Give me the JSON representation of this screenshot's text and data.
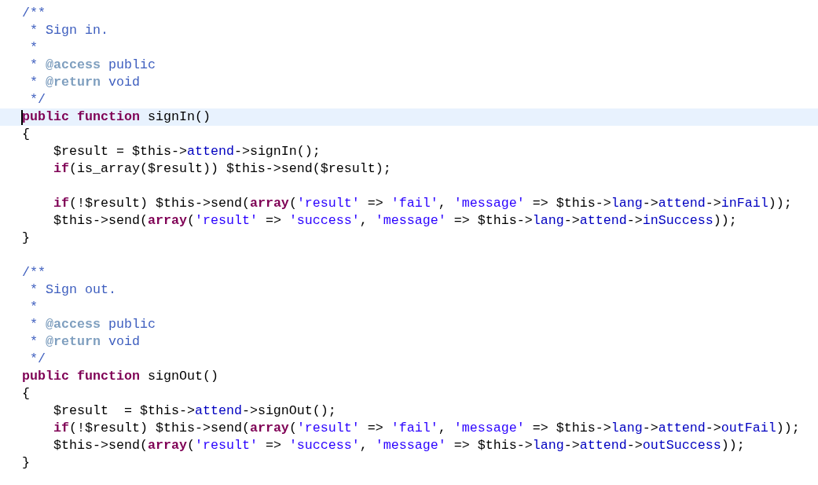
{
  "editor": {
    "lines": [
      {
        "kind": "code",
        "current": false,
        "tokens": [
          {
            "kind": "comment",
            "text": "/**"
          }
        ]
      },
      {
        "kind": "code",
        "current": false,
        "tokens": [
          {
            "kind": "comment",
            "text": " * Sign in."
          }
        ]
      },
      {
        "kind": "code",
        "current": false,
        "tokens": [
          {
            "kind": "comment",
            "text": " *"
          }
        ]
      },
      {
        "kind": "code",
        "current": false,
        "tokens": [
          {
            "kind": "comment",
            "text": " * "
          },
          {
            "kind": "doctag",
            "text": "@access"
          },
          {
            "kind": "comment",
            "text": " public"
          }
        ]
      },
      {
        "kind": "code",
        "current": false,
        "tokens": [
          {
            "kind": "comment",
            "text": " * "
          },
          {
            "kind": "doctag",
            "text": "@return"
          },
          {
            "kind": "comment",
            "text": " void"
          }
        ]
      },
      {
        "kind": "code",
        "current": false,
        "tokens": [
          {
            "kind": "comment",
            "text": " */"
          }
        ]
      },
      {
        "kind": "code",
        "current": true,
        "tokens": [
          {
            "kind": "keyword",
            "text": "public"
          },
          {
            "kind": "keyword",
            "text": " function"
          },
          {
            "kind": "plain",
            "text": " signIn()"
          }
        ]
      },
      {
        "kind": "code",
        "current": false,
        "tokens": [
          {
            "kind": "plain",
            "text": "{"
          }
        ]
      },
      {
        "kind": "code",
        "current": false,
        "tokens": [
          {
            "kind": "plain",
            "text": "    $result = $this->"
          },
          {
            "kind": "field",
            "text": "attend"
          },
          {
            "kind": "plain",
            "text": "->signIn();"
          }
        ]
      },
      {
        "kind": "code",
        "current": false,
        "tokens": [
          {
            "kind": "keyword",
            "text": "    if"
          },
          {
            "kind": "plain",
            "text": "(is_array($result)) $this->send($result);"
          }
        ]
      },
      {
        "kind": "blank",
        "current": false
      },
      {
        "kind": "code",
        "current": false,
        "tokens": [
          {
            "kind": "keyword",
            "text": "    if"
          },
          {
            "kind": "plain",
            "text": "(!$result) $this->send("
          },
          {
            "kind": "keyword",
            "text": "array"
          },
          {
            "kind": "plain",
            "text": "("
          },
          {
            "kind": "string",
            "text": "'result'"
          },
          {
            "kind": "plain",
            "text": " => "
          },
          {
            "kind": "string",
            "text": "'fail'"
          },
          {
            "kind": "plain",
            "text": ", "
          },
          {
            "kind": "string",
            "text": "'message'"
          },
          {
            "kind": "plain",
            "text": " => $this->"
          },
          {
            "kind": "field",
            "text": "lang"
          },
          {
            "kind": "plain",
            "text": "->"
          },
          {
            "kind": "field",
            "text": "attend"
          },
          {
            "kind": "plain",
            "text": "->"
          },
          {
            "kind": "field",
            "text": "inFail"
          },
          {
            "kind": "plain",
            "text": "));"
          }
        ]
      },
      {
        "kind": "code",
        "current": false,
        "tokens": [
          {
            "kind": "plain",
            "text": "    $this->send("
          },
          {
            "kind": "keyword",
            "text": "array"
          },
          {
            "kind": "plain",
            "text": "("
          },
          {
            "kind": "string",
            "text": "'result'"
          },
          {
            "kind": "plain",
            "text": " => "
          },
          {
            "kind": "string",
            "text": "'success'"
          },
          {
            "kind": "plain",
            "text": ", "
          },
          {
            "kind": "string",
            "text": "'message'"
          },
          {
            "kind": "plain",
            "text": " => $this->"
          },
          {
            "kind": "field",
            "text": "lang"
          },
          {
            "kind": "plain",
            "text": "->"
          },
          {
            "kind": "field",
            "text": "attend"
          },
          {
            "kind": "plain",
            "text": "->"
          },
          {
            "kind": "field",
            "text": "inSuccess"
          },
          {
            "kind": "plain",
            "text": "));"
          }
        ]
      },
      {
        "kind": "code",
        "current": false,
        "tokens": [
          {
            "kind": "plain",
            "text": "}"
          }
        ]
      },
      {
        "kind": "blank",
        "current": false
      },
      {
        "kind": "code",
        "current": false,
        "tokens": [
          {
            "kind": "comment",
            "text": "/**"
          }
        ]
      },
      {
        "kind": "code",
        "current": false,
        "tokens": [
          {
            "kind": "comment",
            "text": " * Sign out."
          }
        ]
      },
      {
        "kind": "code",
        "current": false,
        "tokens": [
          {
            "kind": "comment",
            "text": " *"
          }
        ]
      },
      {
        "kind": "code",
        "current": false,
        "tokens": [
          {
            "kind": "comment",
            "text": " * "
          },
          {
            "kind": "doctag",
            "text": "@access"
          },
          {
            "kind": "comment",
            "text": " public"
          }
        ]
      },
      {
        "kind": "code",
        "current": false,
        "tokens": [
          {
            "kind": "comment",
            "text": " * "
          },
          {
            "kind": "doctag",
            "text": "@return"
          },
          {
            "kind": "comment",
            "text": " void"
          }
        ]
      },
      {
        "kind": "code",
        "current": false,
        "tokens": [
          {
            "kind": "comment",
            "text": " */"
          }
        ]
      },
      {
        "kind": "code",
        "current": false,
        "tokens": [
          {
            "kind": "keyword",
            "text": "public"
          },
          {
            "kind": "keyword",
            "text": " function"
          },
          {
            "kind": "plain",
            "text": " signOut()"
          }
        ]
      },
      {
        "kind": "code",
        "current": false,
        "tokens": [
          {
            "kind": "plain",
            "text": "{"
          }
        ]
      },
      {
        "kind": "code",
        "current": false,
        "tokens": [
          {
            "kind": "plain",
            "text": "    $result  = $this->"
          },
          {
            "kind": "field",
            "text": "attend"
          },
          {
            "kind": "plain",
            "text": "->signOut();"
          }
        ]
      },
      {
        "kind": "code",
        "current": false,
        "tokens": [
          {
            "kind": "keyword",
            "text": "    if"
          },
          {
            "kind": "plain",
            "text": "(!$result) $this->send("
          },
          {
            "kind": "keyword",
            "text": "array"
          },
          {
            "kind": "plain",
            "text": "("
          },
          {
            "kind": "string",
            "text": "'result'"
          },
          {
            "kind": "plain",
            "text": " => "
          },
          {
            "kind": "string",
            "text": "'fail'"
          },
          {
            "kind": "plain",
            "text": ", "
          },
          {
            "kind": "string",
            "text": "'message'"
          },
          {
            "kind": "plain",
            "text": " => $this->"
          },
          {
            "kind": "field",
            "text": "lang"
          },
          {
            "kind": "plain",
            "text": "->"
          },
          {
            "kind": "field",
            "text": "attend"
          },
          {
            "kind": "plain",
            "text": "->"
          },
          {
            "kind": "field",
            "text": "outFail"
          },
          {
            "kind": "plain",
            "text": "));"
          }
        ]
      },
      {
        "kind": "code",
        "current": false,
        "tokens": [
          {
            "kind": "plain",
            "text": "    $this->send("
          },
          {
            "kind": "keyword",
            "text": "array"
          },
          {
            "kind": "plain",
            "text": "("
          },
          {
            "kind": "string",
            "text": "'result'"
          },
          {
            "kind": "plain",
            "text": " => "
          },
          {
            "kind": "string",
            "text": "'success'"
          },
          {
            "kind": "plain",
            "text": ", "
          },
          {
            "kind": "string",
            "text": "'message'"
          },
          {
            "kind": "plain",
            "text": " => $this->"
          },
          {
            "kind": "field",
            "text": "lang"
          },
          {
            "kind": "plain",
            "text": "->"
          },
          {
            "kind": "field",
            "text": "attend"
          },
          {
            "kind": "plain",
            "text": "->"
          },
          {
            "kind": "field",
            "text": "outSuccess"
          },
          {
            "kind": "plain",
            "text": "));"
          }
        ]
      },
      {
        "kind": "code",
        "current": false,
        "tokens": [
          {
            "kind": "plain",
            "text": "}"
          }
        ]
      }
    ]
  }
}
